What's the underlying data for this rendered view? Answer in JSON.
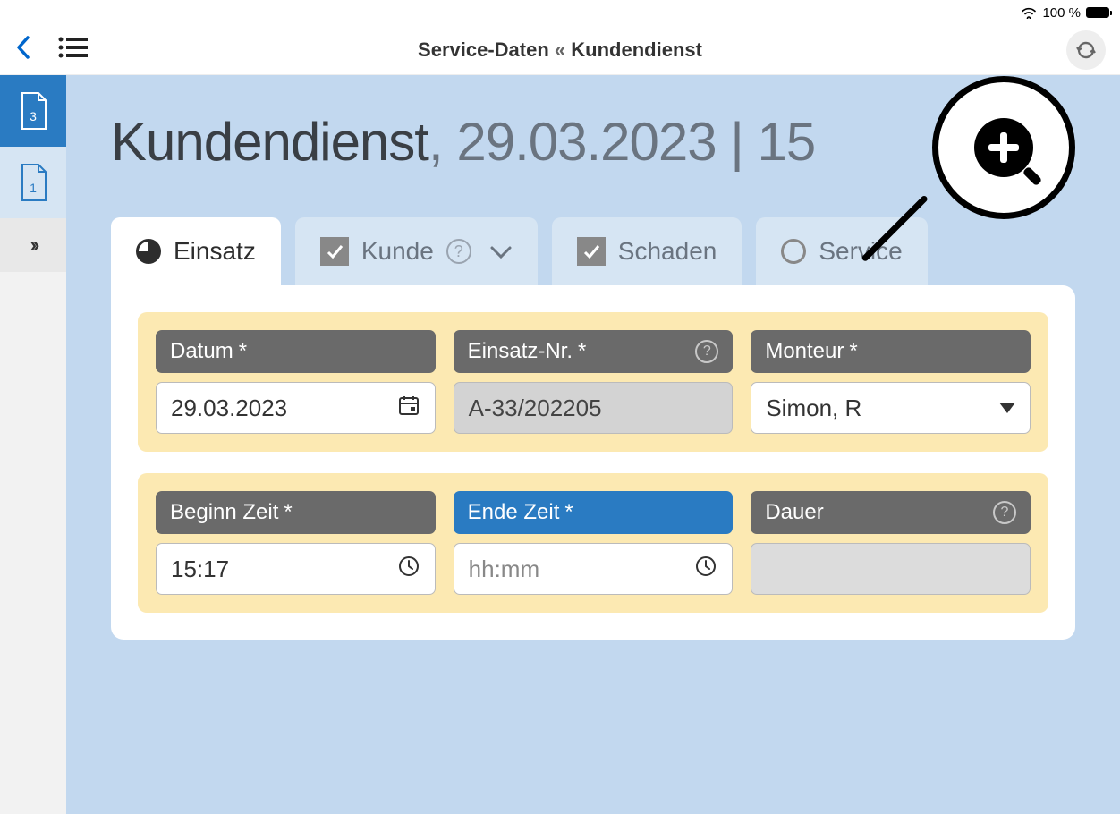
{
  "status": {
    "battery_percent": "100 %"
  },
  "nav": {
    "title_left": "Service-Daten",
    "title_sep": "«",
    "title_right": "Kundendienst"
  },
  "sidebar": {
    "doc_active_count": "3",
    "doc_inactive_count": "1"
  },
  "heading": {
    "title": "Kundendienst",
    "subtitle": "29.03.2023 | 15"
  },
  "tabs": [
    {
      "label": "Einsatz"
    },
    {
      "label": "Kunde"
    },
    {
      "label": "Schaden"
    },
    {
      "label": "Service"
    }
  ],
  "fields": {
    "datum": {
      "label": "Datum",
      "value": "29.03.2023",
      "required": "*"
    },
    "einsatz_nr": {
      "label": "Einsatz-Nr.",
      "value": "A-33/202205",
      "required": "*"
    },
    "monteur": {
      "label": "Monteur",
      "value": "Simon, R",
      "required": "*"
    },
    "beginn": {
      "label": "Beginn Zeit",
      "value": "15:17",
      "required": "*"
    },
    "ende": {
      "label": "Ende Zeit",
      "value": "",
      "placeholder": "hh:mm",
      "required": "*"
    },
    "dauer": {
      "label": "Dauer",
      "value": ""
    }
  }
}
